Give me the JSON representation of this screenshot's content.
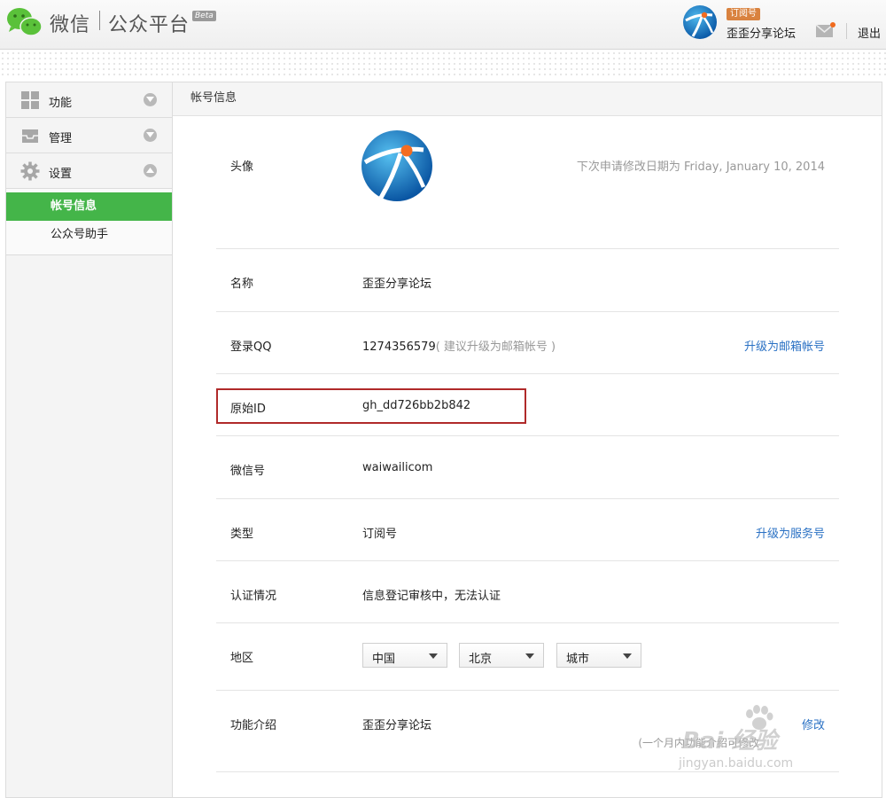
{
  "header": {
    "app_name": "微信",
    "sub_name": "公众平台",
    "beta": "Beta",
    "account_type": "订阅号",
    "account_name": "歪歪分享论坛",
    "logout": "退出"
  },
  "sidebar": {
    "groups": [
      {
        "label": "功能",
        "icon": "grid-icon"
      },
      {
        "label": "管理",
        "icon": "inbox-icon"
      },
      {
        "label": "设置",
        "icon": "gear-icon"
      }
    ],
    "sub_items": [
      {
        "label": "帐号信息",
        "active": true
      },
      {
        "label": "公众号助手",
        "active": false
      }
    ]
  },
  "main": {
    "title": "帐号信息",
    "avatar": {
      "label": "头像",
      "note": "下次申请修改日期为 Friday, January 10, 2014"
    },
    "name": {
      "label": "名称",
      "value": "歪歪分享论坛"
    },
    "qq": {
      "label": "登录QQ",
      "value": "1274356579",
      "hint": "( 建议升级为邮箱帐号 )",
      "action": "升级为邮箱帐号"
    },
    "original_id": {
      "label": "原始ID",
      "value": "gh_dd726bb2b842"
    },
    "wechat_id": {
      "label": "微信号",
      "value": "waiwailicom"
    },
    "type": {
      "label": "类型",
      "value": "订阅号",
      "action": "升级为服务号"
    },
    "verify": {
      "label": "认证情况",
      "value": "信息登记审核中，无法认证"
    },
    "region": {
      "label": "地区",
      "country": "中国",
      "province": "北京",
      "city": "城市"
    },
    "intro": {
      "label": "功能介绍",
      "value": "歪歪分享论坛",
      "action": "修改",
      "note": "(一个月内功能介绍可修改"
    }
  },
  "watermark": {
    "brand": "Bai 经验",
    "url": "jingyan.baidu.com"
  },
  "colors": {
    "active_green": "#44b549",
    "link_blue": "#2a71c4",
    "highlight_red": "#b02a2a",
    "badge_orange": "#d9823f"
  }
}
